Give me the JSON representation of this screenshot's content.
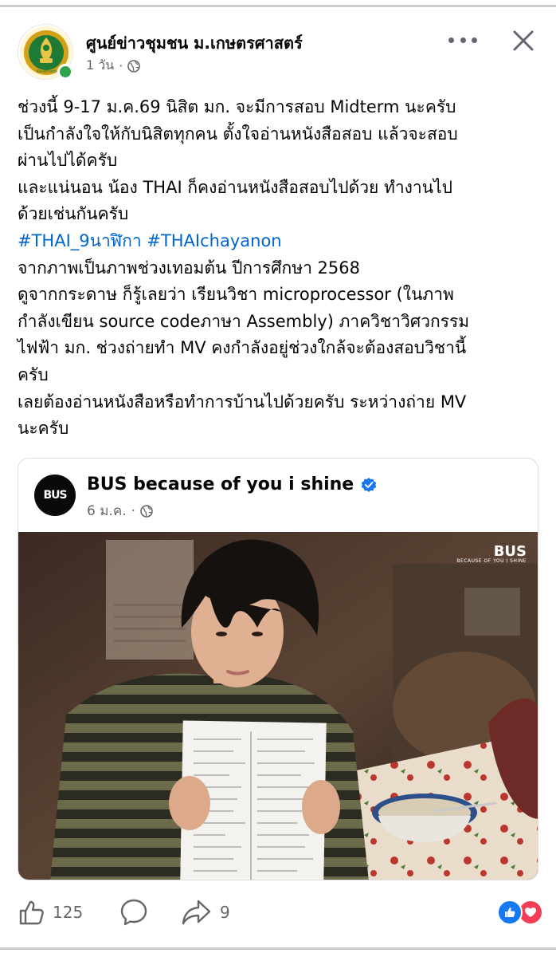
{
  "post": {
    "page_name": "ศูนย์ข่าวชุมชน ม.เกษตรศาสตร์",
    "time": "1 วัน",
    "separator": "·",
    "logo_label": "Kasetsart",
    "caption_lines": [
      "ช่วงนี้ 9-17 ม.ค.69 นิสิต มก. จะมีการสอบ Midterm นะครับ",
      "เป็นกำลังใจให้กับนิสิตทุกคน ตั้งใจอ่านหนังสือสอบ แล้วจะสอบ",
      "ผ่านไปได้ครับ",
      "และแน่นอน น้อง THAI ก็คงอ่านหนังสือสอบไปด้วย ทำงานไป",
      "ด้วยเช่นกันครับ"
    ],
    "hashtags": [
      "#THAI_9นาฬิกา",
      "#THAIchayanon"
    ],
    "caption_lines_2": [
      "จากภาพเป็นภาพช่วงเทอมต้น ปีการศึกษา 2568",
      "ดูจากกระดาษ ก็รู้เลยว่า เรียนวิชา microprocessor (ในภาพ",
      "กำลังเขียน source codeภาษา Assembly) ภาควิชาวิศวกรรม",
      "ไฟฟ้า มก. ช่วงถ่ายทำ MV คงกำลังอยู่ช่วงใกล้จะต้องสอบวิชานี้",
      "ครับ",
      "เลยต้องอ่านหนังสือหรือทำการบ้านไปด้วยครับ ระหว่างถ่าย MV",
      "นะครับ"
    ]
  },
  "shared": {
    "logo_text": "BUS",
    "page_name": "BUS because of you i shine",
    "date": "6 ม.ค.",
    "separator": "·",
    "photo_logo": "BUS",
    "photo_logo_sub": "BECAUSE OF YOU I SHINE"
  },
  "actions": {
    "like_count": "125",
    "share_count": "9"
  },
  "colors": {
    "hashtag": "#0064d1",
    "meta": "#65676b",
    "online": "#31a24c",
    "like_blue": "#1877f2",
    "love_red": "#f33e58"
  },
  "icons": {
    "more": "more-icon",
    "close": "close-icon",
    "globe": "globe-icon",
    "verified": "verified-badge-icon",
    "like": "thumbs-up-icon",
    "comment": "comment-icon",
    "share": "share-icon"
  }
}
